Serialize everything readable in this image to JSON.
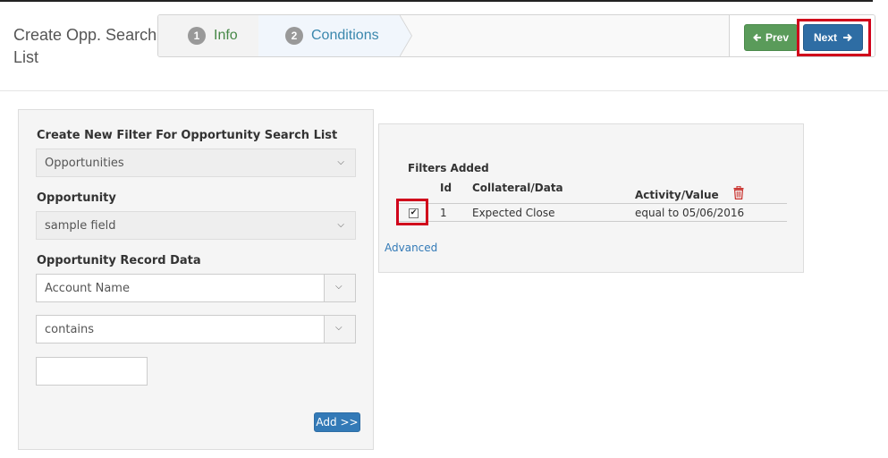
{
  "header": {
    "title": "Create Opp. Search List",
    "steps": [
      {
        "num": "1",
        "label": "Info"
      },
      {
        "num": "2",
        "label": "Conditions"
      }
    ],
    "prev_label": "Prev",
    "next_label": "Next"
  },
  "left_panel": {
    "create_label": "Create New Filter For Opportunity Search List",
    "create_select": "Opportunities",
    "opportunity_label": "Opportunity",
    "opportunity_select": "sample field",
    "record_label": "Opportunity Record Data",
    "record_select": "Account Name",
    "operator_select": "contains",
    "value_input": "",
    "add_label": "Add >>"
  },
  "right_panel": {
    "title": "Filters Added",
    "columns": {
      "id": "Id",
      "collateral": "Collateral/Data",
      "activity": "Activity/Value"
    },
    "rows": [
      {
        "id": "1",
        "collateral": "Expected Close",
        "activity": "equal to 05/06/2016",
        "checked": true
      }
    ],
    "advanced_label": "Advanced"
  },
  "colors": {
    "highlight": "#d0021b",
    "primary": "#337ab7",
    "success": "#5a9b5a",
    "danger": "#c9302c"
  },
  "icons": {
    "prev": "arrow-left-icon",
    "next": "arrow-right-icon",
    "trash": "trash-icon",
    "caret": "chevron-down-icon"
  }
}
